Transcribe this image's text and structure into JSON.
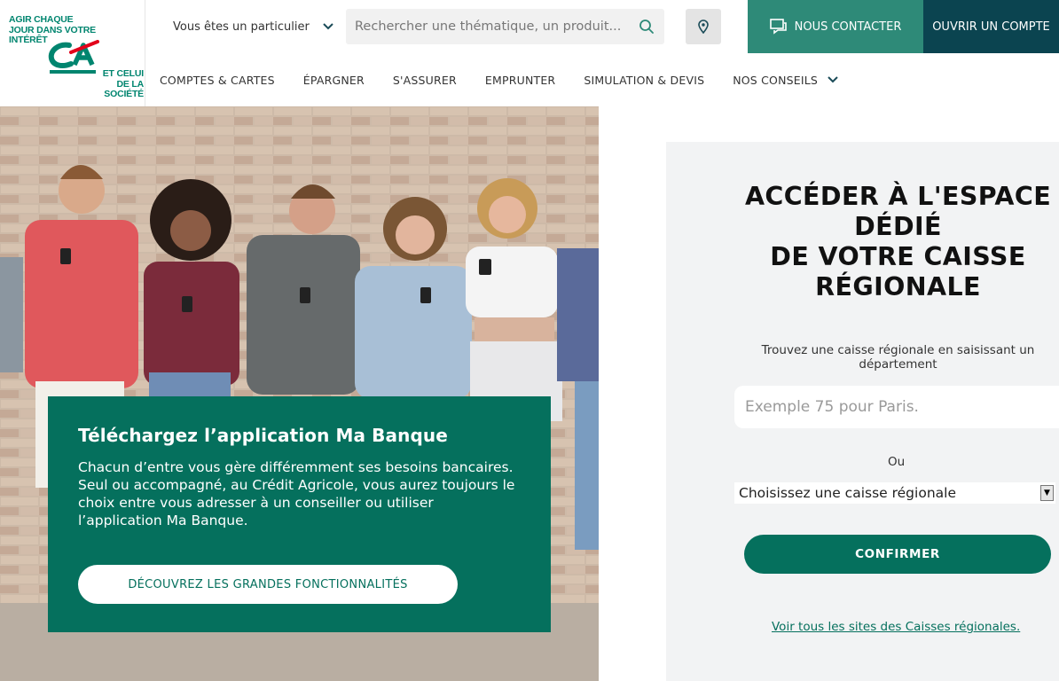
{
  "brand": {
    "tagline_top": "AGIR CHAQUE JOUR DANS VOTRE INTÉRÊT",
    "tagline_bottom": "ET CELUI DE LA SOCIÉTÉ",
    "logo_icon": "credit-agricole-ca-logo",
    "color_primary": "#05705d",
    "color_teal": "#2e8a78",
    "color_dark": "#0b4450",
    "color_red": "#e2001a"
  },
  "header": {
    "profile_label": "Vous êtes un particulier",
    "search_placeholder": "Rechercher une thématique, un produit...",
    "contact_label": "NOUS CONTACTER",
    "open_account_label": "OUVRIR UN COMPTE"
  },
  "nav": {
    "items": [
      {
        "label": "COMPTES & CARTES"
      },
      {
        "label": "ÉPARGNER"
      },
      {
        "label": "S'ASSURER"
      },
      {
        "label": "EMPRUNTER"
      },
      {
        "label": "SIMULATION & DEVIS"
      },
      {
        "label": "NOS CONSEILS"
      }
    ]
  },
  "promo": {
    "title": "Téléchargez l’application Ma Banque",
    "line1": "Chacun d’entre vous gère différemment ses besoins bancaires.",
    "line2": "Seul ou accompagné, au Crédit Agricole, vous aurez toujours le choix entre vous adresser à un conseiller ou utiliser l’application Ma Banque.",
    "cta": "DÉCOUVREZ LES GRANDES FONCTIONNALITÉS"
  },
  "regional": {
    "title_lines": [
      "ACCÉDER À L'ESPACE",
      "DÉDIÉ",
      "DE VOTRE CAISSE",
      "RÉGIONALE"
    ],
    "hint": "Trouvez une caisse régionale en saisissant un département",
    "input_placeholder": "Exemple 75 pour Paris.",
    "or_label": "Ou",
    "select_value": "Choisissez une caisse régionale",
    "confirm_label": "CONFIRMER",
    "all_sites_link": "Voir tous les sites des Caisses régionales."
  }
}
